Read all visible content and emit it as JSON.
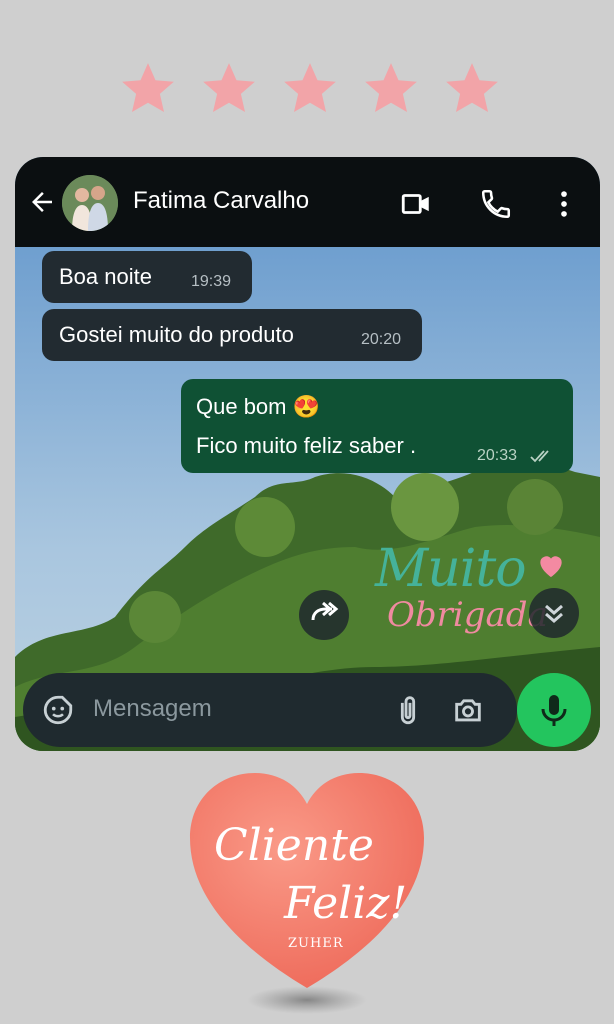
{
  "rating": {
    "stars": 5,
    "color": "#f2a4a8"
  },
  "chat": {
    "contact_name": "Fatima Carvalho",
    "header_icons": [
      "back-arrow-icon",
      "video-call-icon",
      "phone-call-icon",
      "more-options-icon"
    ],
    "messages": [
      {
        "direction": "incoming",
        "lines": [
          "Boa noite"
        ],
        "time": "19:39"
      },
      {
        "direction": "incoming",
        "lines": [
          "Gostei muito do produto"
        ],
        "time": "20:20"
      },
      {
        "direction": "outgoing",
        "lines": [
          "Que bom 😍",
          "Fico muito feliz  saber ."
        ],
        "time": "20:33",
        "status": "read"
      }
    ],
    "composer": {
      "placeholder": "Mensagem"
    },
    "sticker": {
      "line1": "Muito",
      "line2": "Obrigada"
    }
  },
  "heart": {
    "line1": "Cliente",
    "line2": "Feliz!",
    "brand": "ZUHER",
    "color": "#f47c6c"
  },
  "colors": {
    "background": "#cfcfcf",
    "topbar": "#0b0f11",
    "incoming_bubble": "#222b31",
    "outgoing_bubble": "#0f5134",
    "mic_button": "#23c55e"
  }
}
